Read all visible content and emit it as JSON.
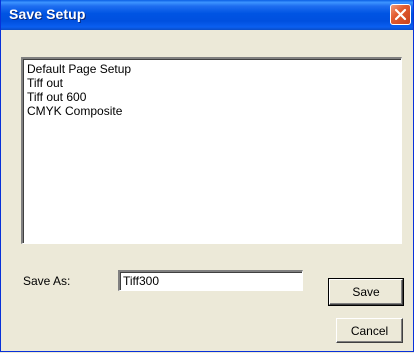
{
  "window": {
    "title": "Save Setup"
  },
  "setups": {
    "items": [
      "Default Page Setup",
      "Tiff out",
      "Tiff out 600",
      "CMYK Composite"
    ]
  },
  "save_as": {
    "label": "Save As:",
    "value": "Tiff300"
  },
  "buttons": {
    "save_label": "Save",
    "cancel_label": "Cancel"
  },
  "icons": {
    "close": "close-icon"
  },
  "colors": {
    "titlebar": "#0054e3",
    "close_button": "#e25b2f",
    "dialog_background": "#ece9d8"
  }
}
